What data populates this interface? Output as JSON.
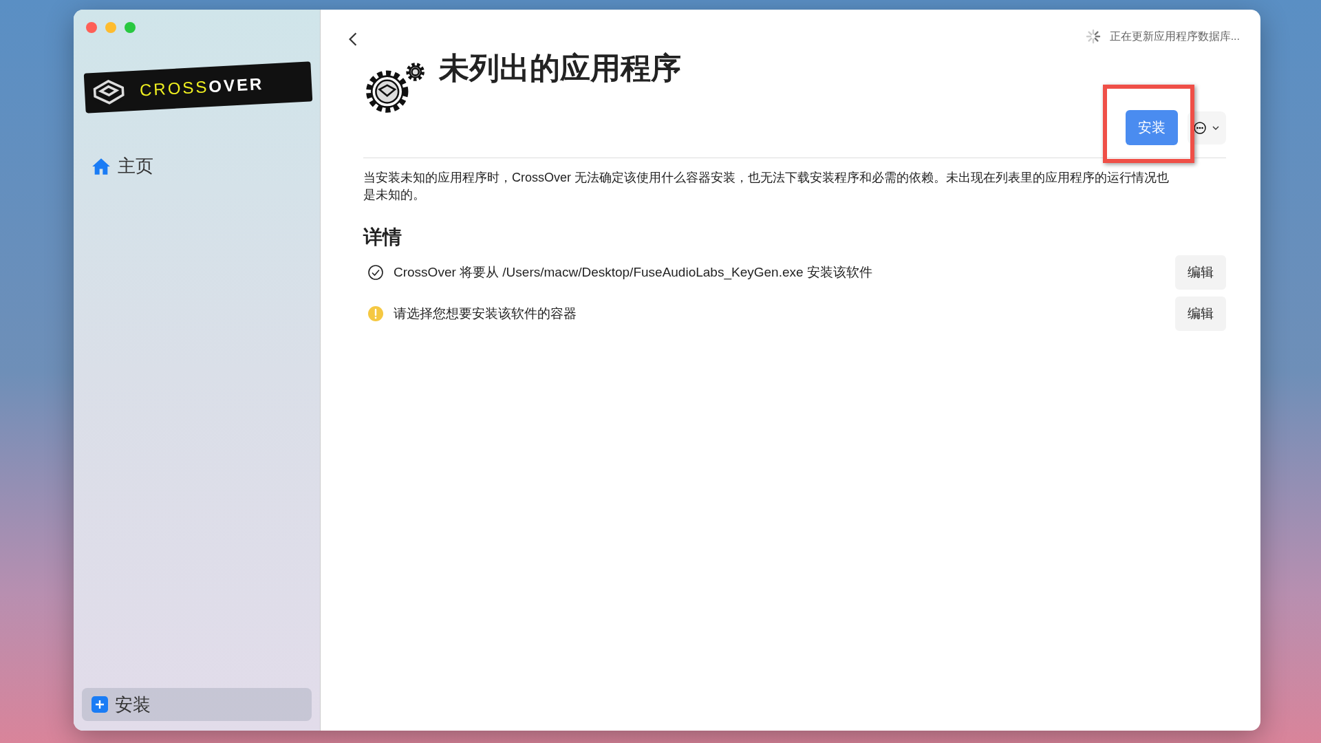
{
  "sidebar": {
    "logo": {
      "light": "CROSS",
      "bold": "OVER"
    },
    "items": [
      {
        "label": "主页",
        "selected": false
      }
    ],
    "install_button": {
      "label": "安装",
      "selected": true
    }
  },
  "status": "正在更新应用程序数据库...",
  "title": "未列出的应用程序",
  "install_button": {
    "label": "安装",
    "highlighted": true
  },
  "description": "当安装未知的应用程序时，CrossOver 无法确定该使用什么容器安装，也无法下载安装程序和必需的依赖。未出现在列表里的应用程序的运行情况也是未知的。",
  "details": {
    "heading": "详情",
    "rows": [
      {
        "kind": "ok",
        "text": "CrossOver 将要从 /Users/macw/Desktop/FuseAudioLabs_KeyGen.exe 安装该软件",
        "button": "编辑"
      },
      {
        "kind": "warning",
        "text": "请选择您想要安装该软件的容器",
        "button": "编辑"
      }
    ]
  }
}
